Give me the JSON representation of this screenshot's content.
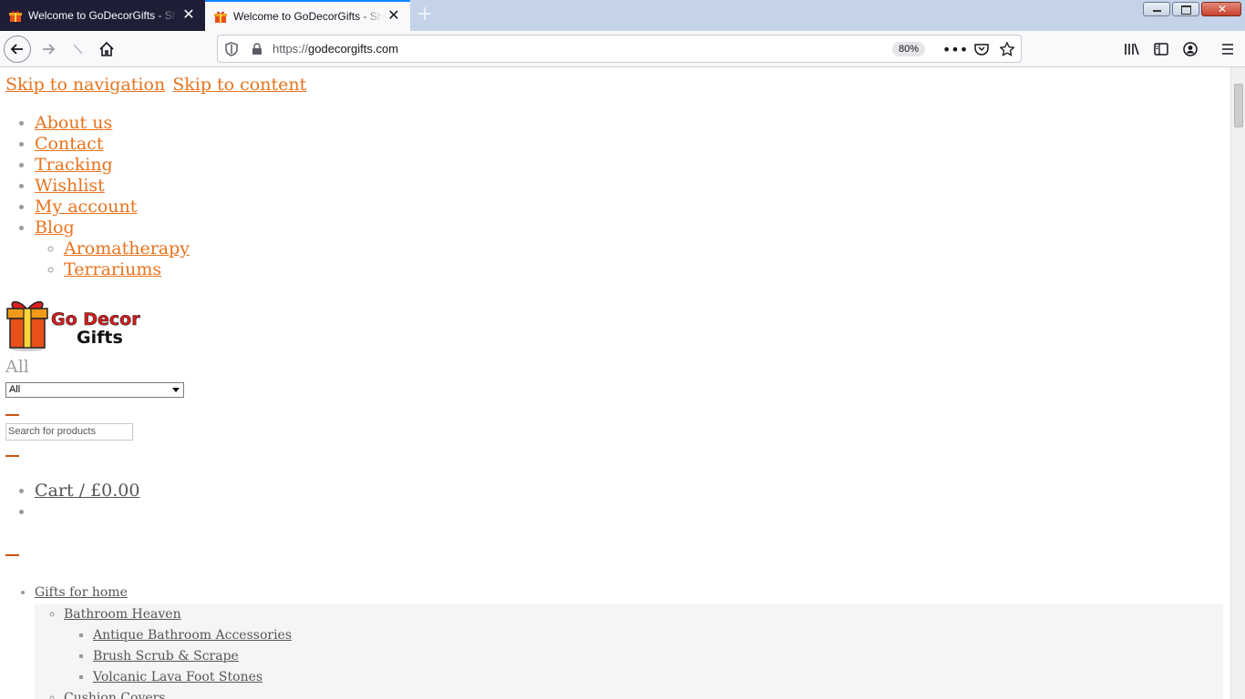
{
  "browser": {
    "tabs": [
      {
        "title": "Welcome to GoDecorGifts - Shop",
        "active": false
      },
      {
        "title": "Welcome to GoDecorGifts - Shop",
        "active": true
      }
    ],
    "url_protocol": "https://",
    "url_host": "godecorgifts.com",
    "zoom": "80%"
  },
  "page": {
    "skip_navigation": "Skip to navigation",
    "skip_content": "Skip to content",
    "top_menu": [
      "About us",
      "Contact",
      "Tracking",
      "Wishlist",
      "My account",
      "Blog"
    ],
    "blog_submenu": [
      "Aromatherapy",
      "Terrariums"
    ],
    "logo_text_line1": "Go Decor",
    "logo_text_line2": "Gifts",
    "category_label": "All",
    "category_select_value": "All",
    "search_placeholder": "Search for products",
    "cart_label": "Cart / £0.00",
    "main_nav": {
      "item": "Gifts for home",
      "sub": "Bathroom Heaven",
      "sub_items": [
        "Antique Bathroom Accessories",
        "Brush Scrub & Scrape",
        "Volcanic Lava Foot Stones"
      ],
      "next_sub": "Cushion Covers"
    }
  },
  "colors": {
    "link": "#e8731e",
    "accent_dash": "#c8540f"
  }
}
